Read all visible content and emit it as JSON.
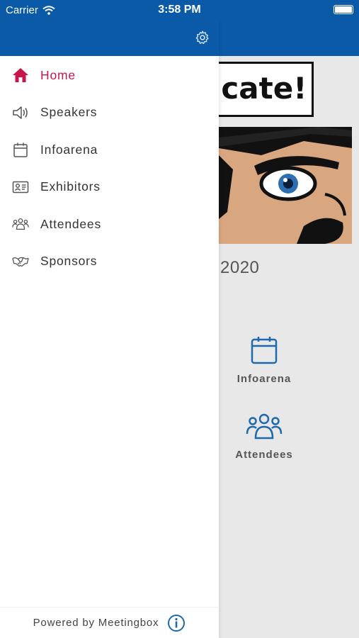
{
  "status": {
    "carrier": "Carrier",
    "time": "3:58 PM"
  },
  "drawer": {
    "items": [
      {
        "label": "Home",
        "icon": "home-icon",
        "active": true
      },
      {
        "label": "Speakers",
        "icon": "speaker-icon"
      },
      {
        "label": "Infoarena",
        "icon": "calendar-icon"
      },
      {
        "label": "Exhibitors",
        "icon": "id-card-icon"
      },
      {
        "label": "Attendees",
        "icon": "people-icon"
      },
      {
        "label": "Sponsors",
        "icon": "handshake-icon"
      }
    ],
    "footer": "Powered by Meetingbox"
  },
  "main": {
    "banner_text": "icate!",
    "year": "2020",
    "tiles": [
      {
        "label": "Infoarena",
        "icon": "calendar-icon"
      },
      {
        "label": "Attendees",
        "icon": "people-icon"
      }
    ]
  },
  "colors": {
    "brand": "#0a5aa8",
    "active": "#c8154b",
    "icon_blue": "#1f6aad"
  }
}
